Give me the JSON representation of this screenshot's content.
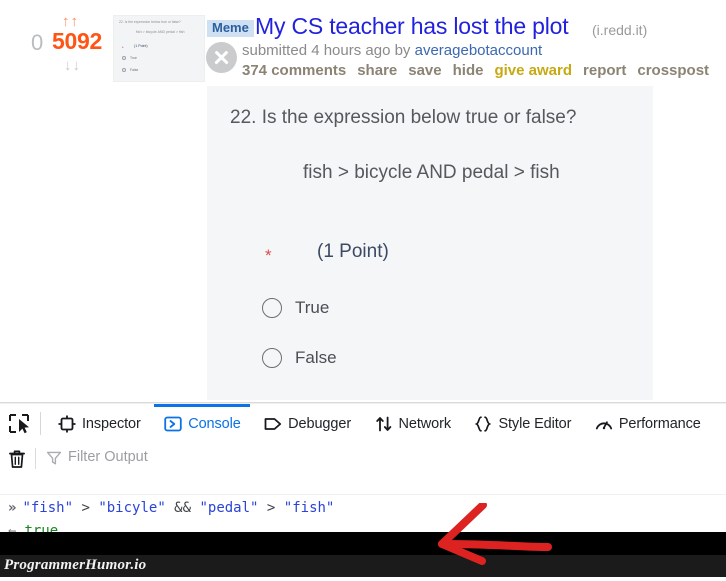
{
  "post": {
    "vote": {
      "upvote_icon": "upvote-arrow",
      "upvote_glyph": "↑↑",
      "downvote_glyph": "↓↓",
      "zero": "0",
      "score": "5092"
    },
    "flair": "Meme",
    "title": "My CS teacher has lost the plot",
    "domain": "(i.redd.it)",
    "submitted_prefix": "submitted 4 hours ago by ",
    "author": "averagebotaccount",
    "actions": [
      {
        "label": "374 comments",
        "style": "normal"
      },
      {
        "label": "share",
        "style": "normal"
      },
      {
        "label": "save",
        "style": "normal"
      },
      {
        "label": "hide",
        "style": "normal"
      },
      {
        "label": "give award",
        "style": "award"
      },
      {
        "label": "report",
        "style": "normal"
      },
      {
        "label": "crosspost",
        "style": "normal"
      }
    ]
  },
  "quiz": {
    "question_number": "22.",
    "question_text": "Is the expression below true or false?",
    "expression": "fish > bicycle AND pedal > fish",
    "required_mark": "*",
    "points": "(1 Point)",
    "options": [
      {
        "label": "True",
        "selected": false
      },
      {
        "label": "False",
        "selected": false
      }
    ]
  },
  "devtools": {
    "picker_icon": "element-picker-icon",
    "tabs": [
      {
        "label": "Inspector",
        "icon": "inspector-target-icon",
        "active": false
      },
      {
        "label": "Console",
        "icon": "console-chevron-icon",
        "active": true
      },
      {
        "label": "Debugger",
        "icon": "debugger-tag-icon",
        "active": false
      },
      {
        "label": "Network",
        "icon": "network-arrows-icon",
        "active": false
      },
      {
        "label": "Style Editor",
        "icon": "style-editor-braces-icon",
        "active": false
      },
      {
        "label": "Performance",
        "icon": "performance-gauge-icon",
        "active": false
      }
    ],
    "filter": {
      "trash_icon": "trash-icon",
      "funnel_icon": "filter-funnel-icon",
      "placeholder": "Filter Output",
      "value": ""
    },
    "console": {
      "input_prompt": "»",
      "input_parts": [
        {
          "text": "\"fish\"",
          "kind": "string"
        },
        {
          "text": " > ",
          "kind": "operator"
        },
        {
          "text": "\"bicyle\"",
          "kind": "string"
        },
        {
          "text": " && ",
          "kind": "operator"
        },
        {
          "text": "\"pedal\"",
          "kind": "string"
        },
        {
          "text": " > ",
          "kind": "operator"
        },
        {
          "text": "\"fish\"",
          "kind": "string"
        }
      ],
      "input_text": "\"fish\" > \"bicyle\" && \"pedal\" > \"fish\"",
      "output_prompt": "←",
      "output_value": "true"
    }
  },
  "annotation": {
    "arrow_icon": "red-arrow-annotation",
    "arrow_color": "#dd2222"
  },
  "watermark": "ProgrammerHumor.io",
  "colors": {
    "score_orange": "#ff5414",
    "title_blue": "#2222dd",
    "award_gold": "#c7a912",
    "console_blue": "#0b72e7",
    "true_green": "#18861f",
    "string_blue": "#2a43d8",
    "panel_bg": "#f5f6f8"
  }
}
